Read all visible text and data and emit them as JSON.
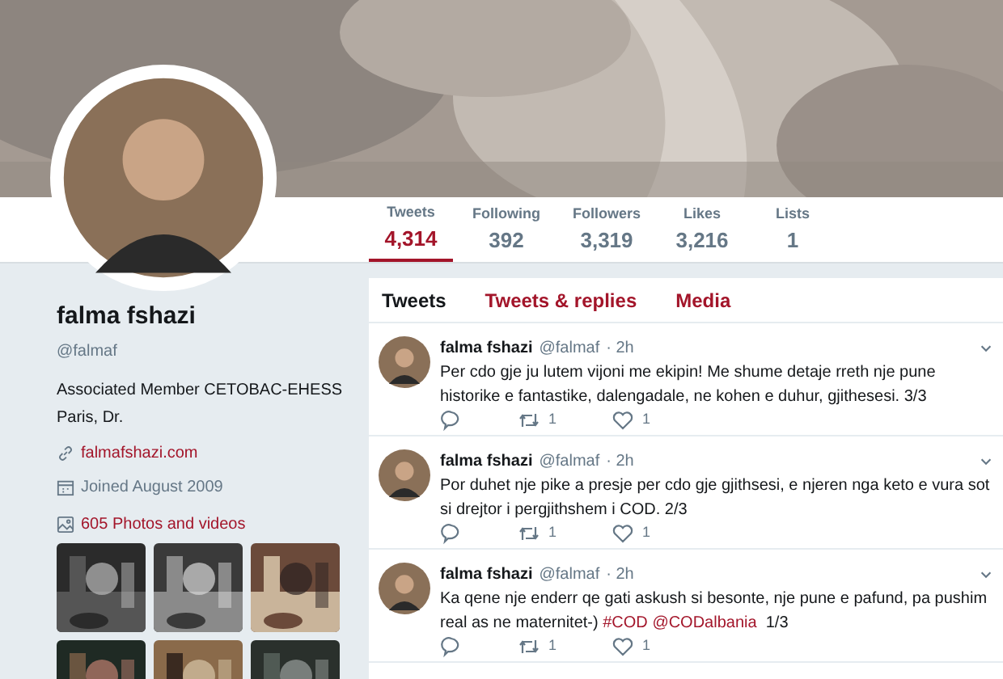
{
  "stats": [
    {
      "label": "Tweets",
      "value": "4,314",
      "selected": true
    },
    {
      "label": "Following",
      "value": "392",
      "selected": false
    },
    {
      "label": "Followers",
      "value": "3,319",
      "selected": false
    },
    {
      "label": "Likes",
      "value": "3,216",
      "selected": false
    },
    {
      "label": "Lists",
      "value": "1",
      "selected": false
    }
  ],
  "profile": {
    "name": "falma fshazi",
    "handle": "@falmaf",
    "bio": "Associated Member CETOBAC-EHESS Paris, Dr.",
    "website": "falmafshazi.com",
    "joined": "Joined August 2009",
    "media_link": "605 Photos and videos"
  },
  "timeline_tabs": [
    {
      "label": "Tweets",
      "selected": true
    },
    {
      "label": "Tweets & replies",
      "selected": false
    },
    {
      "label": "Media",
      "selected": false
    }
  ],
  "tweets": [
    {
      "name": "falma fshazi",
      "handle": "@falmaf",
      "time": "· 2h",
      "text": [
        {
          "kind": "text",
          "text": "Per cdo gje ju lutem vijoni me ekipin! Me shume detaje rreth nje pune historike e fantastike, dalengadale, ne kohen e duhur, gjithesesi. 3/3"
        }
      ],
      "retweets": "1",
      "likes": "1"
    },
    {
      "name": "falma fshazi",
      "handle": "@falmaf",
      "time": "· 2h",
      "text": [
        {
          "kind": "text",
          "text": "Por duhet nje pike a presje per cdo gje gjithsesi, e njeren nga keto e vura sot si drejtor i pergjithshem i COD. 2/3"
        }
      ],
      "retweets": "1",
      "likes": "1"
    },
    {
      "name": "falma fshazi",
      "handle": "@falmaf",
      "time": "· 2h",
      "text": [
        {
          "kind": "text",
          "text": "Ka qene nje enderr qe gati askush si besonte, nje pune e pafund, pa pushim real as ne maternitet-) "
        },
        {
          "kind": "link",
          "text": "#COD"
        },
        {
          "kind": "link",
          "text": "@CODalbania"
        },
        {
          "kind": "text",
          "text": "  1/3"
        }
      ],
      "retweets": "1",
      "likes": "1"
    }
  ]
}
